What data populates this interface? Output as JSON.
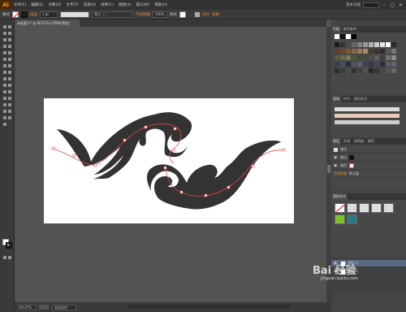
{
  "app": {
    "logo": "Ai"
  },
  "menu": {
    "items": [
      "文件(F)",
      "编辑(E)",
      "对象(O)",
      "文字(T)",
      "选择(S)",
      "效果(C)",
      "视图(V)",
      "窗口(W)",
      "帮助(H)"
    ],
    "workspace": "基本功能",
    "min": "–",
    "max": "▢",
    "close": "✕"
  },
  "control": {
    "mode_label": "路径",
    "stroke_label": "描边",
    "stroke_value": "1 pt",
    "brush_size_value": "等比",
    "opacity_label": "不透明度",
    "opacity_value": "100%",
    "style_label": "样式",
    "align_label": "对齐",
    "transform_label": "变换"
  },
  "document": {
    "tab_title": "未标题-1* @ 66.67% (CMYK/预览)"
  },
  "status": {
    "zoom": "66.67%",
    "tool": "直接选择"
  },
  "panels": {
    "swatches": {
      "tabs": [
        "色板",
        "颜色参考"
      ]
    },
    "swatch_colors": [
      [
        "#1a1a1a",
        "#333333",
        "#4d4d4d",
        "#666666",
        "#808080",
        "#999999",
        "#b3b3b3",
        "#cccccc",
        "#e6e6e6",
        "#ffffff",
        "#2a2a2a"
      ],
      [
        "#5c4033",
        "#6b4a2e",
        "#7a5a3a",
        "#8b6b47",
        "#9c7c56",
        "#a58d6b",
        "#4a3b2a",
        "#3d3428",
        "#2d2d2d",
        "#555",
        "#777"
      ],
      [
        "#5a5a40",
        "#6a6a4a",
        "#7a7a55",
        "#4d5a3d",
        "#3d4d3a",
        "#4a4a3a",
        "#505050",
        "#606060",
        "#404040",
        "#707070",
        "#888"
      ],
      [
        "#3a3d4d",
        "#4a4d5d",
        "#2d3040",
        "#505566",
        "#5d6070",
        "#40434f",
        "#353845",
        "#454857",
        "#2a2d38",
        "#585b6a",
        "#666"
      ],
      [
        "#2a2d2a",
        "#3a3d3a",
        "#4a4d4a",
        "#303330",
        "#404340",
        "#505350",
        "#252825",
        "#353835",
        "#454845",
        "#555855",
        "#656865"
      ]
    ],
    "brushes": {
      "tabs": [
        "画笔",
        "符号",
        "图形样式"
      ]
    },
    "layers": {
      "tabs": [
        "图层",
        "外观",
        "透明度",
        "颜色"
      ],
      "title": "路径",
      "rows": [
        "描边",
        "填色",
        "不透明度"
      ],
      "stroke_value": "",
      "fill_value": "",
      "opacity_value": "默认值"
    },
    "graphic_styles": {
      "title": "图形样式"
    },
    "layer_list": {
      "rows": [
        "图层 1",
        "图层 2"
      ]
    }
  },
  "watermark": {
    "brand": "Bai 经验",
    "url": "jingyan.baidu.com"
  },
  "colors": {
    "accent": "#e88b2a",
    "path": "#e24b4b",
    "ink": "#333333"
  }
}
